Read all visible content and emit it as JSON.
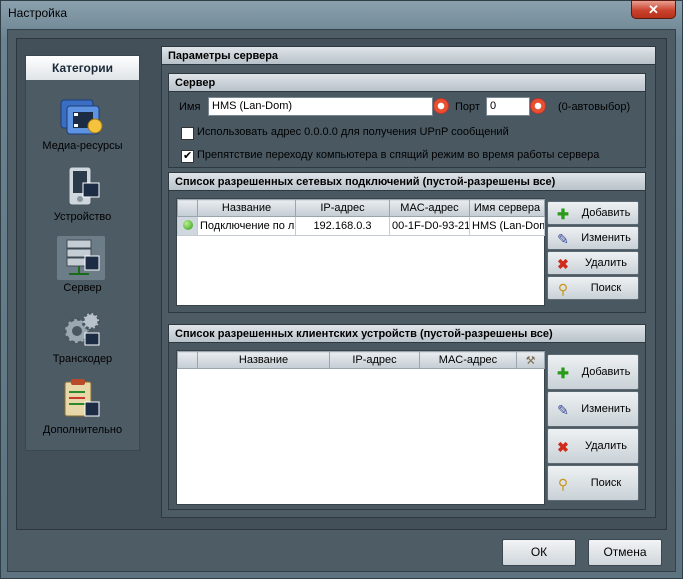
{
  "window": {
    "title": "Настройка",
    "close_label": "✕"
  },
  "sidebar": {
    "header": "Категории",
    "items": [
      {
        "label": "Медиа-ресурсы",
        "icon": "media-resources-icon"
      },
      {
        "label": "Устройство",
        "icon": "device-icon"
      },
      {
        "label": "Сервер",
        "icon": "server-icon",
        "selected": true
      },
      {
        "label": "Транскодер",
        "icon": "transcoder-icon"
      },
      {
        "label": "Дополнительно",
        "icon": "additional-icon"
      }
    ]
  },
  "main": {
    "title": "Параметры сервера",
    "server": {
      "header": "Сервер",
      "name_label": "Имя",
      "name_value": "HMS (Lan-Dom)",
      "port_label": "Порт",
      "port_value": "0",
      "port_hint": "(0-автовыбор)",
      "opt1": {
        "label": "Использовать адрес 0.0.0.0 для получения UPnP сообщений",
        "checked": false
      },
      "opt2": {
        "label": "Препятствие переходу компьютера в спящий режим во время работы сервера",
        "checked": true
      }
    },
    "networks": {
      "header": "Список разрешенных сетевых подключений (пустой-разрешены все)",
      "columns": [
        "Название",
        "IP-адрес",
        "MAC-адрес",
        "Имя сервера"
      ],
      "rows": [
        {
          "name": "Подключение по л",
          "ip": "192.168.0.3",
          "mac": "00-1F-D0-93-21",
          "server": "HMS (Lan-Dom"
        }
      ],
      "buttons": {
        "add": "Добавить",
        "edit": "Изменить",
        "delete": "Удалить",
        "search": "Поиск"
      }
    },
    "clients": {
      "header": "Список разрешенных клиентских устройств (пустой-разрешены все)",
      "columns": [
        "Название",
        "IP-адрес",
        "MAC-адрес"
      ],
      "buttons": {
        "add": "Добавить",
        "edit": "Изменить",
        "delete": "Удалить",
        "search": "Поиск"
      }
    }
  },
  "footer": {
    "ok": "ОК",
    "cancel": "Отмена"
  }
}
